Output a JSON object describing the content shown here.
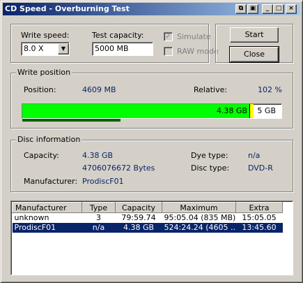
{
  "window": {
    "title": "CD Speed - Overburning Test"
  },
  "settings": {
    "write_speed_label": "Write speed:",
    "write_speed_value": "8.0 X",
    "test_capacity_label": "Test capacity:",
    "test_capacity_value": "5000 MB",
    "simulate_label": "Simulate",
    "raw_mode_label": "RAW mode",
    "simulate_checked": true,
    "raw_mode_checked": false
  },
  "buttons": {
    "start": "Start",
    "close": "Close"
  },
  "write_position": {
    "title": "Write position",
    "position_label": "Position:",
    "position_value": "4609 MB",
    "relative_label": "Relative:",
    "relative_value": "102 %",
    "disc_mark_label": "4.38 GB",
    "end_label": "5 GB",
    "progress_fraction": 0.922,
    "disc_mark_fraction": 0.876,
    "sub_progress_fraction": 0.38,
    "bar_color": "#00ff00",
    "marker_color": "#ffff00"
  },
  "disc_info": {
    "title": "Disc information",
    "capacity_label": "Capacity:",
    "capacity_value": "4.38 GB",
    "capacity_bytes": "4706076672 Bytes",
    "manufacturer_label": "Manufacturer:",
    "manufacturer_value": "ProdiscF01",
    "dye_type_label": "Dye type:",
    "dye_type_value": "n/a",
    "disc_type_label": "Disc type:",
    "disc_type_value": "DVD-R"
  },
  "results": {
    "columns": [
      "Manufacturer",
      "Type",
      "Capacity",
      "Maximum",
      "Extra"
    ],
    "rows": [
      [
        "unknown",
        "3",
        "79:59.74",
        "95:05.04 (835 MB)",
        "15:05.05"
      ],
      [
        "ProdiscF01",
        "n/a",
        "4.38 GB",
        "524:24.24 (4605 ...",
        "13:45.60"
      ]
    ],
    "selected_row": 1
  }
}
